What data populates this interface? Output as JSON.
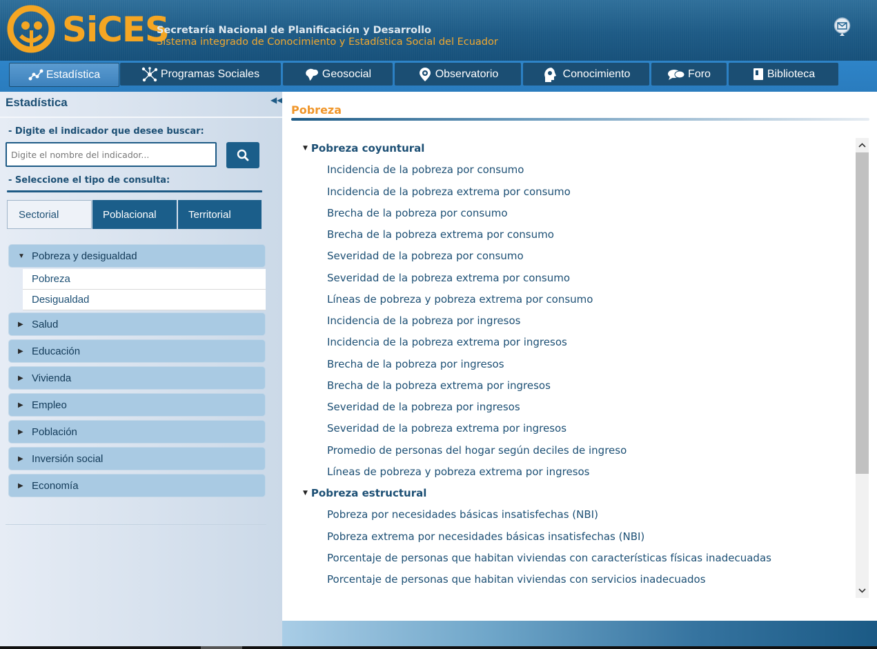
{
  "header": {
    "logo_text": "SiCES",
    "org_name": "Secretaría Nacional de Planificación y Desarrollo",
    "system_name": "Sistema integrado de Conocimiento y Estadística Social del Ecuador",
    "colors": {
      "header_bg": "#1d5a85",
      "accent_orange": "#f5a623"
    }
  },
  "nav": {
    "items": [
      {
        "label": "Estadística",
        "icon": "chart-nodes-icon",
        "active": true
      },
      {
        "label": "Programas Sociales",
        "icon": "network-icon"
      },
      {
        "label": "Geosocial",
        "icon": "map-icon"
      },
      {
        "label": "Observatorio",
        "icon": "eye-pin-icon"
      },
      {
        "label": "Conocimiento",
        "icon": "head-icon"
      },
      {
        "label": "Foro",
        "icon": "chat-bubbles-icon"
      },
      {
        "label": "Biblioteca",
        "icon": "book-icon"
      }
    ]
  },
  "sidebar": {
    "title": "Estadística",
    "search_label": "- Digite el indicador que desee buscar:",
    "search_placeholder": "Digite el nombre del indicador...",
    "query_label": "- Seleccione el tipo de consulta:",
    "query_tabs": [
      "Sectorial",
      "Poblacional",
      "Territorial"
    ],
    "selected_tab": "Sectorial",
    "categories": [
      {
        "label": "Pobreza y desigualdad",
        "expanded": true,
        "subitems": [
          "Pobreza",
          "Desigualdad"
        ]
      },
      {
        "label": "Salud"
      },
      {
        "label": "Educación"
      },
      {
        "label": "Vivienda"
      },
      {
        "label": "Empleo"
      },
      {
        "label": "Población"
      },
      {
        "label": "Inversión social"
      },
      {
        "label": "Economía"
      }
    ]
  },
  "main": {
    "title": "Pobreza",
    "groups": [
      {
        "title": "Pobreza coyuntural",
        "items": [
          "Incidencia de la pobreza por consumo",
          "Incidencia de la pobreza extrema por consumo",
          "Brecha de la pobreza por consumo",
          "Brecha de la pobreza extrema por consumo",
          "Severidad de la pobreza por consumo",
          "Severidad de la pobreza extrema por consumo",
          "Líneas de pobreza y pobreza extrema por consumo",
          "Incidencia de la pobreza por ingresos",
          "Incidencia de la pobreza extrema por ingresos",
          "Brecha de la pobreza por ingresos",
          "Brecha de la pobreza extrema por ingresos",
          "Severidad de la pobreza por ingresos",
          "Severidad de la pobreza extrema por ingresos",
          "Promedio de personas del hogar según deciles de ingreso",
          "Líneas de pobreza y pobreza extrema por ingresos"
        ]
      },
      {
        "title": "Pobreza estructural",
        "items": [
          "Pobreza por necesidades básicas insatisfechas (NBI)",
          "Pobreza extrema por necesidades básicas insatisfechas (NBI)",
          "Porcentaje de personas que habitan viviendas con características físicas inadecuadas",
          "Porcentaje de personas que habitan viviendas con servicios inadecuados"
        ]
      }
    ]
  }
}
